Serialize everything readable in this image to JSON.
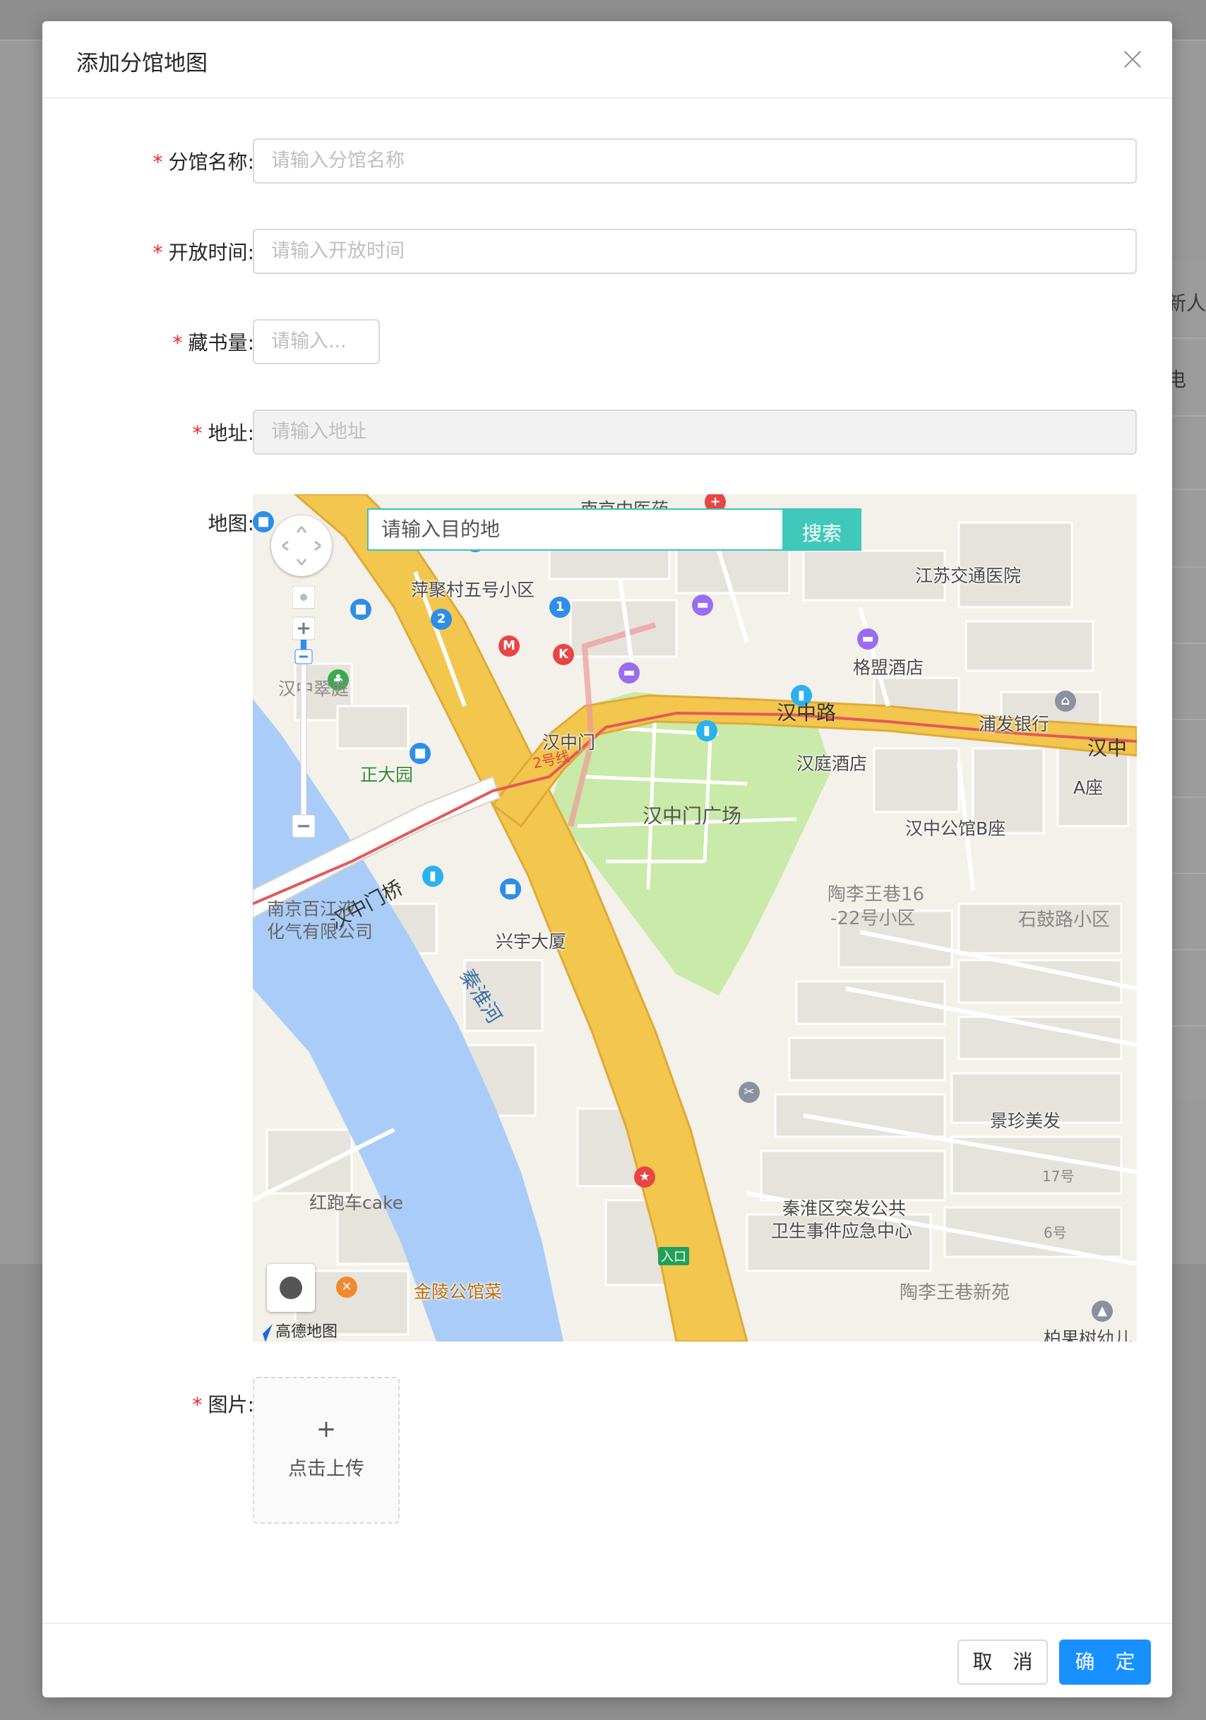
{
  "background": {
    "column_header_text": "新人",
    "cell_text": "电"
  },
  "dialog": {
    "title": "添加分馆地图",
    "fields": {
      "name": {
        "label": "分馆名称",
        "required_mark": "*",
        "placeholder": "请输入分馆名称"
      },
      "open_time": {
        "label": "开放时间",
        "required_mark": "*",
        "placeholder": "请输入开放时间"
      },
      "book_count": {
        "label": "藏书量",
        "required_mark": "*",
        "placeholder": "请输入..."
      },
      "address": {
        "label": "地址",
        "required_mark": "*",
        "placeholder": "请输入地址"
      },
      "map": {
        "label": "地图"
      },
      "image": {
        "label": "图片",
        "required_mark": "*"
      }
    },
    "colon": ":",
    "map": {
      "search_placeholder": "请输入目的地",
      "search_button": "搜索",
      "brand": "高德地图",
      "labels": {
        "nanjing_hospital": "南京中医药",
        "pingju": "萍聚村五号小区",
        "jiangsu_hospital": "江苏交通医院",
        "gemeng_hotel": "格盟酒店",
        "hanzhong_road": "汉中路",
        "pufa_bank": "浦发银行",
        "hanzhong_right": "汉中",
        "hanzhong_cuiting": "汉中翠庭",
        "line2": "2号线",
        "hanzhongmen_station": "汉中门",
        "hanting_hotel": "汉庭酒店",
        "a_zuo": "A座",
        "zhengda_garden": "正大园",
        "hanzhongmen_bridge": "汉中门桥",
        "hanzhongmen_square": "汉中门广场",
        "hanzhong_b": "汉中公馆B座",
        "taoli_16": "陶李王巷16",
        "taoli_22": "-22号小区",
        "shigu_road": "石鼓路小区",
        "baijiang_1": "南京百江液",
        "baijiang_2": "化气有限公司",
        "xingyu": "兴宇大厦",
        "qinhuai_river": "秦淮河",
        "jingzhen": "景珍美发",
        "no17": "17号",
        "no6": "6号",
        "red_car_cake": "红跑车cake",
        "public_health_1": "秦淮区突发公共",
        "public_health_2": "卫生事件应急中心",
        "jinling": "金陵公馆菜",
        "taoli_new": "陶李王巷新苑",
        "entrance": "入口",
        "baiguoshu": "柏果树幼儿"
      }
    },
    "upload": {
      "plus": "+",
      "label": "点击上传"
    },
    "footer": {
      "cancel": "取 消",
      "ok": "确 定"
    }
  }
}
